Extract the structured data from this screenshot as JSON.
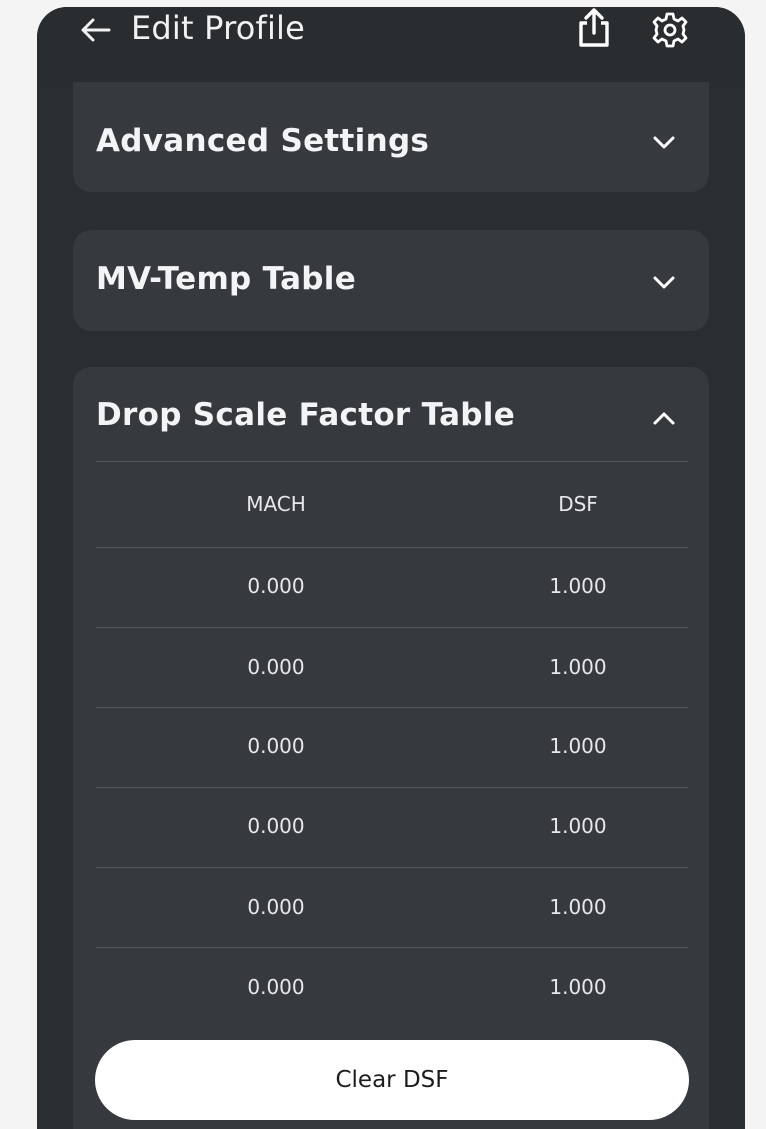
{
  "header": {
    "title": "Edit Profile",
    "back_icon": "arrow-left-icon",
    "share_icon": "share-icon",
    "settings_icon": "gear-icon"
  },
  "sections": {
    "advanced": {
      "title": "Advanced Settings",
      "state": "collapsed"
    },
    "mv_temp": {
      "title": "MV-Temp Table",
      "state": "collapsed"
    },
    "dsf": {
      "title": "Drop Scale Factor Table",
      "state": "expanded",
      "columns": [
        "MACH",
        "DSF"
      ],
      "rows": [
        [
          "0.000",
          "1.000"
        ],
        [
          "0.000",
          "1.000"
        ],
        [
          "0.000",
          "1.000"
        ],
        [
          "0.000",
          "1.000"
        ],
        [
          "0.000",
          "1.000"
        ],
        [
          "0.000",
          "1.000"
        ]
      ],
      "clear_label": "Clear DSF"
    }
  },
  "colors": {
    "background": "#2b2e31",
    "card": "#363a3e",
    "text": "#f3f4f5",
    "button": "#ffffff"
  }
}
